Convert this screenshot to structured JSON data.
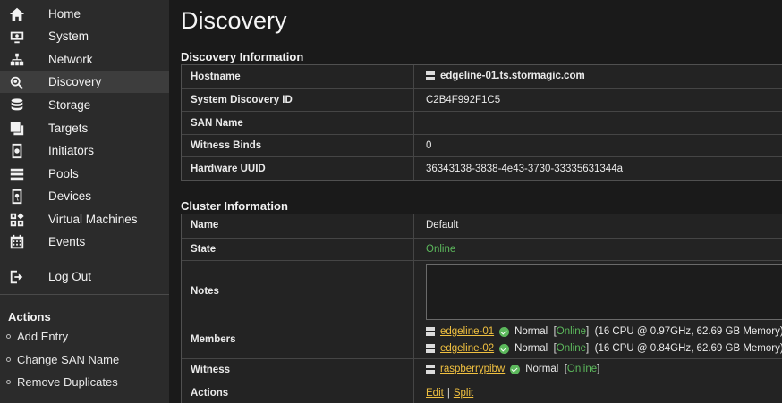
{
  "sidebar": {
    "nav": [
      {
        "label": "Home",
        "icon": "home-icon"
      },
      {
        "label": "System",
        "icon": "system-icon"
      },
      {
        "label": "Network",
        "icon": "network-icon"
      },
      {
        "label": "Discovery",
        "icon": "discovery-icon",
        "active": true
      },
      {
        "label": "Storage",
        "icon": "storage-icon"
      },
      {
        "label": "Targets",
        "icon": "targets-icon"
      },
      {
        "label": "Initiators",
        "icon": "initiators-icon"
      },
      {
        "label": "Pools",
        "icon": "pools-icon"
      },
      {
        "label": "Devices",
        "icon": "devices-icon"
      },
      {
        "label": "Virtual Machines",
        "icon": "virtual-machines-icon"
      },
      {
        "label": "Events",
        "icon": "events-icon"
      },
      {
        "label": "Log Out",
        "icon": "logout-icon"
      }
    ],
    "actions_heading": "Actions",
    "actions": [
      "Add Entry",
      "Change SAN Name",
      "Remove Duplicates"
    ]
  },
  "page": {
    "title": "Discovery"
  },
  "discovery_info": {
    "heading": "Discovery Information",
    "rows": [
      {
        "label": "Hostname",
        "value": "edgeline-01.ts.stormagic.com"
      },
      {
        "label": "System Discovery ID",
        "value": "C2B4F992F1C5"
      },
      {
        "label": "SAN Name",
        "value": ""
      },
      {
        "label": "Witness Binds",
        "value": "0"
      },
      {
        "label": "Hardware UUID",
        "value": "36343138-3838-4e43-3730-33335631344a"
      }
    ]
  },
  "cluster_info": {
    "heading": "Cluster Information",
    "name_label": "Name",
    "name_value": "Default",
    "state_label": "State",
    "state_value": "Online",
    "notes_label": "Notes",
    "notes_value": "",
    "members_label": "Members",
    "members": [
      {
        "name": "edgeline-01",
        "status": "Normal",
        "state_open": "[",
        "state": "Online",
        "state_close": "]",
        "specs": "(16 CPU @ 0.97GHz, 62.69 GB Memory)"
      },
      {
        "name": "edgeline-02",
        "status": "Normal",
        "state_open": "[",
        "state": "Online",
        "state_close": "]",
        "specs": "(16 CPU @ 0.84GHz, 62.69 GB Memory)"
      }
    ],
    "witness_label": "Witness",
    "witness": {
      "name": "raspberrypibw",
      "status": "Normal",
      "state_open": "[",
      "state": "Online",
      "state_close": "]"
    },
    "actions_label": "Actions",
    "actions": {
      "edit": "Edit",
      "separator": "|",
      "split": "Split"
    }
  },
  "colors": {
    "online": "#5cb85c",
    "link": "#f0c040",
    "sidebar_bg": "#2b2b2b",
    "page_bg": "#1a1a1a"
  }
}
